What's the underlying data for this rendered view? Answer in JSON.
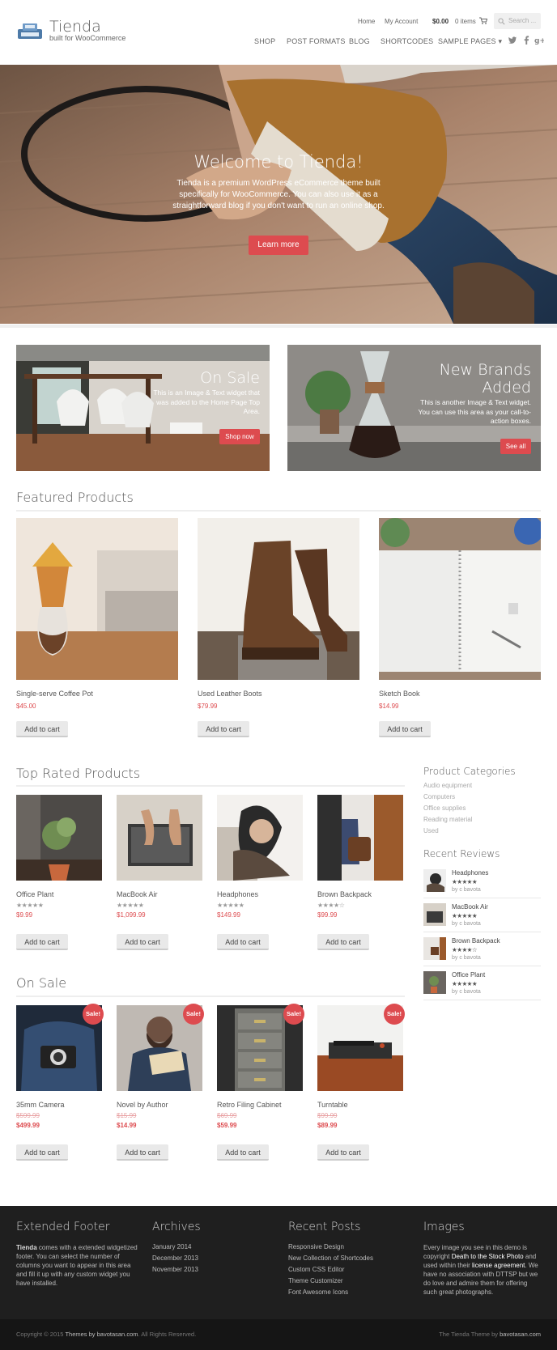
{
  "header": {
    "logo_title": "Tienda",
    "logo_subtitle": "built for WooCommerce",
    "top_links": [
      "Home",
      "My Account"
    ],
    "cart_total": "$0.00",
    "cart_items": "0 items",
    "search_placeholder": "Search ...",
    "nav": [
      "SHOP",
      "POST FORMATS",
      "BLOG",
      "SHORTCODES",
      "SAMPLE PAGES ▾"
    ],
    "social": [
      "twitter-icon",
      "facebook-icon",
      "google-plus-icon"
    ]
  },
  "hero": {
    "title": "Welcome to Tienda!",
    "text": "Tienda is a premium WordPress eCommerce theme built specifically for WooCommerce. You can also use it as a straightforward blog if you don't want to run an online shop.",
    "button": "Learn more"
  },
  "promos": [
    {
      "title": "On Sale",
      "text": "This is an Image & Text widget that was added to the Home Page Top Area.",
      "button": "Shop now"
    },
    {
      "title": "New Brands Added",
      "text": "This is another Image & Text widget. You can use this area as your call-to-action boxes.",
      "button": "See all"
    }
  ],
  "featured": {
    "title": "Featured Products",
    "products": [
      {
        "name": "Single-serve Coffee Pot",
        "price": "$45.00",
        "button": "Add to cart"
      },
      {
        "name": "Used Leather Boots",
        "price": "$79.99",
        "button": "Add to cart"
      },
      {
        "name": "Sketch Book",
        "price": "$14.99",
        "button": "Add to cart"
      }
    ]
  },
  "top_rated": {
    "title": "Top Rated Products",
    "products": [
      {
        "name": "Office Plant",
        "price": "$9.99",
        "rating": 5,
        "button": "Add to cart"
      },
      {
        "name": "MacBook Air",
        "price": "$1,099.99",
        "rating": 5,
        "button": "Add to cart"
      },
      {
        "name": "Headphones",
        "price": "$149.99",
        "rating": 5,
        "button": "Add to cart"
      },
      {
        "name": "Brown Backpack",
        "price": "$99.99",
        "rating": 4,
        "button": "Add to cart"
      }
    ]
  },
  "on_sale": {
    "title": "On Sale",
    "badge": "Sale!",
    "products": [
      {
        "name": "35mm Camera",
        "old_price": "$599.99",
        "price": "$499.99",
        "button": "Add to cart"
      },
      {
        "name": "Novel by Author",
        "old_price": "$15.99",
        "price": "$14.99",
        "button": "Add to cart"
      },
      {
        "name": "Retro Filing Cabinet",
        "old_price": "$69.99",
        "price": "$59.99",
        "button": "Add to cart"
      },
      {
        "name": "Turntable",
        "old_price": "$99.99",
        "price": "$89.99",
        "button": "Add to cart"
      }
    ]
  },
  "sidebar": {
    "categories_title": "Product Categories",
    "categories": [
      "Audio equipment",
      "Computers",
      "Office supplies",
      "Reading material",
      "Used"
    ],
    "reviews_title": "Recent Reviews",
    "reviews": [
      {
        "name": "Headphones",
        "rating": 5,
        "by": "by c bavota"
      },
      {
        "name": "MacBook Air",
        "rating": 5,
        "by": "by c bavota"
      },
      {
        "name": "Brown Backpack",
        "rating": 4,
        "by": "by c bavota"
      },
      {
        "name": "Office Plant",
        "rating": 5,
        "by": "by c bavota"
      }
    ]
  },
  "footer": {
    "col1_title": "Extended Footer",
    "col1_strong": "Tienda",
    "col1_text": " comes with a extended widgetized footer. You can select the number of columns you want to appear in this area and fill it up with any custom widget you have installed.",
    "col2_title": "Archives",
    "archives": [
      "January 2014",
      "December 2013",
      "November 2013"
    ],
    "col3_title": "Recent Posts",
    "posts": [
      "Responsive Design",
      "New Collection of Shortcodes",
      "Custom CSS Editor",
      "Theme Customizer",
      "Font Awesome Icons"
    ],
    "col4_title": "Images",
    "col4_text_a": "Every image you see in this demo is copyright ",
    "col4_link1": "Death to the Stock Photo",
    "col4_text_b": " and used within their ",
    "col4_link2": "license agreement",
    "col4_text_c": ". We have no association with DTTSP but we do love and admire them for offering such great photographs.",
    "copyright_a": "Copyright © 2015 ",
    "copyright_link": "Themes by bavotasan.com",
    "copyright_b": ". All Rights Reserved.",
    "credit_a": "The Tienda Theme by ",
    "credit_link": "bavotasan.com"
  },
  "colors": {
    "accent": "#dd4b4f",
    "footer_bg": "#1f1f1f"
  }
}
